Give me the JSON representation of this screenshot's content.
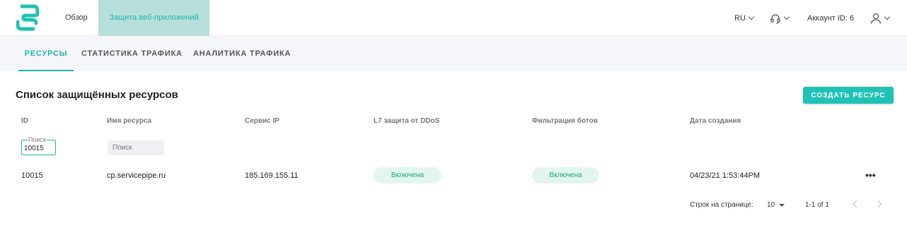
{
  "header": {
    "nav": {
      "overview": "Обзор",
      "waf": "Защита веб-приложений"
    },
    "lang": "RU",
    "account": "Аккаунт ID: 6",
    "colors": {
      "accent": "#1fb5a9",
      "active_nav_bg": "#b8dfdc"
    }
  },
  "tabs": [
    {
      "label": "РЕСУРСЫ",
      "active": true
    },
    {
      "label": "СТАТИСТИКА ТРАФИКА",
      "active": false
    },
    {
      "label": "АНАЛИТИКА ТРАФИКА",
      "active": false
    }
  ],
  "main": {
    "title": "Список защищённых ресурсов",
    "create_button": "СОЗДАТЬ РЕСУРС",
    "columns": [
      "ID",
      "Имя ресурса",
      "Сервис IP",
      "L7 защита от DDoS",
      "Фильтрация ботов",
      "Дата создания"
    ],
    "filters": {
      "id_legend": "Поиск",
      "id_value": "10015",
      "name_placeholder": "Поиск"
    },
    "rows": [
      {
        "id": "10015",
        "name": "cp.servicepipe.ru",
        "ip": "185.169.155.11",
        "ddos": "Включена",
        "bots": "Включена",
        "created": "04/23/21 1:53:44PM",
        "more": "•••"
      }
    ]
  },
  "pagination": {
    "rows_label": "Строк на странице:",
    "page_size": "10",
    "range": "1-1 of 1"
  }
}
